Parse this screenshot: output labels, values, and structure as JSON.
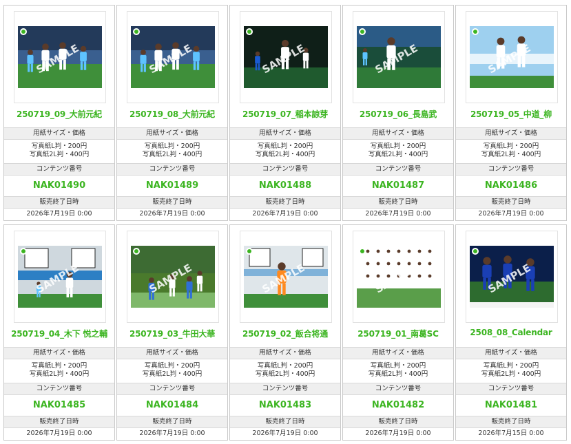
{
  "products": [
    {
      "title": "250719_09_大前元紀",
      "size_label": "用紙サイズ・価格",
      "price_l": "写真紙L判・200円",
      "price_2l": "写真紙2L判・400円",
      "code_label": "コンテンツ番号",
      "code": "NAK01490",
      "end_label": "販売終了日時",
      "end_date": "2026年7月19日 0:00",
      "watermark": "SAMPLE",
      "scene": "players-celebrate",
      "kit": "#ffffff"
    },
    {
      "title": "250719_08_大前元紀",
      "size_label": "用紙サイズ・価格",
      "price_l": "写真紙L判・200円",
      "price_2l": "写真紙2L判・400円",
      "code_label": "コンテンツ番号",
      "code": "NAK01489",
      "end_label": "販売終了日時",
      "end_date": "2026年7月19日 0:00",
      "watermark": "SAMPLE",
      "scene": "players-celebrate",
      "kit": "#ffffff"
    },
    {
      "title": "250719_07_稲本諒芽",
      "size_label": "用紙サイズ・価格",
      "price_l": "写真紙L判・200円",
      "price_2l": "写真紙2L判・400円",
      "code_label": "コンテンツ番号",
      "code": "NAK01488",
      "end_label": "販売終了日時",
      "end_date": "2026年7月19日 0:00",
      "watermark": "SAMPLE",
      "scene": "night-dribble",
      "kit": "#ffffff"
    },
    {
      "title": "250719_06_長島武",
      "size_label": "用紙サイズ・価格",
      "price_l": "写真紙L判・200円",
      "price_2l": "写真紙2L判・400円",
      "code_label": "コンテンツ番号",
      "code": "NAK01487",
      "end_label": "販売終了日時",
      "end_date": "2026年7月19日 0:00",
      "watermark": "SAMPLE",
      "scene": "player-running",
      "kit": "#ffffff"
    },
    {
      "title": "250719_05_中道_柳",
      "size_label": "用紙サイズ・価格",
      "price_l": "写真紙L判・200円",
      "price_2l": "写真紙2L判・400円",
      "code_label": "コンテンツ番号",
      "code": "NAK01486",
      "end_label": "販売終了日時",
      "end_date": "2026年7月19日 0:00",
      "watermark": "SAMPLE",
      "scene": "high-five",
      "kit": "#ffffff"
    },
    {
      "title": "250719_04_木下 悦之輔",
      "size_label": "用紙サイズ・価格",
      "price_l": "写真紙L判・200円",
      "price_2l": "写真紙2L判・400円",
      "code_label": "コンテンツ番号",
      "code": "NAK01485",
      "end_label": "販売終了日時",
      "end_date": "2026年7月19日 0:00",
      "watermark": "SAMPLE",
      "scene": "banner-run",
      "kit": "#ffffff"
    },
    {
      "title": "250719_03_牛田大華",
      "size_label": "用紙サイズ・価格",
      "price_l": "写真紙L判・200円",
      "price_2l": "写真紙2L判・400円",
      "code_label": "コンテンツ番号",
      "code": "NAK01484",
      "end_label": "販売終了日時",
      "end_date": "2026年7月19日 0:00",
      "watermark": "SAMPLE",
      "scene": "goalmouth",
      "kit": "#ffffff"
    },
    {
      "title": "250719_02_飯合将通",
      "size_label": "用紙サイズ・価格",
      "price_l": "写真紙L判・200円",
      "price_2l": "写真紙2L判・400円",
      "code_label": "コンテンツ番号",
      "code": "NAK01483",
      "end_label": "販売終了日時",
      "end_date": "2026年7月19日 0:00",
      "watermark": "SAMPLE",
      "scene": "goalkeeper",
      "kit": "#ff8a1f"
    },
    {
      "title": "250719_01_南葛SC",
      "size_label": "用紙サイズ・価格",
      "price_l": "写真紙L判・200円",
      "price_2l": "写真紙2L判・400円",
      "code_label": "コンテンツ番号",
      "code": "NAK01482",
      "end_label": "販売終了日時",
      "end_date": "2026年7月19日 0:00",
      "watermark": "SAMPLE",
      "scene": "team-photo",
      "kit": "#ffffff"
    },
    {
      "title": "2508_08_Calendar",
      "size_label": "用紙サイズ・価格",
      "price_l": "写真紙L判・200円",
      "price_2l": "写真紙2L判・400円",
      "code_label": "コンテンツ番号",
      "code": "NAK01481",
      "end_label": "販売終了日時",
      "end_date": "2026年7月15日 0:00",
      "watermark": "SAMPLE",
      "scene": "calendar",
      "kit": "#1a3fb5"
    }
  ]
}
